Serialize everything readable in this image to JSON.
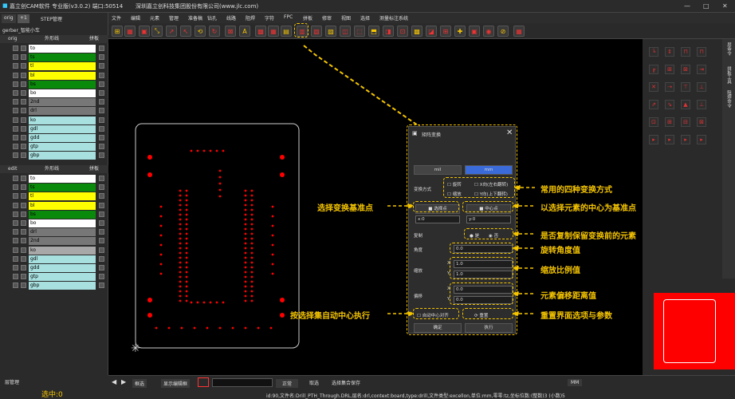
{
  "title": {
    "app": "嘉立创CAM软件 专业版(v3.0.2) 端口:50514",
    "company": "深圳嘉立创科技集团股份有限公司(www.jlc.com)"
  },
  "menus": [
    "文件",
    "编辑",
    "元素",
    "管理",
    "准备稿",
    "钻孔",
    "线路",
    "阻焊",
    "字符",
    "FPC",
    "拼板",
    "修审",
    "视图",
    "选择",
    "测量标注",
    "系统"
  ],
  "left": {
    "tabs": [
      "orig",
      "+1",
      "STEP管理"
    ],
    "job": "gerber_智能小车",
    "orig_head": "orig",
    "orig_opts": [
      "外形线",
      "拼板"
    ],
    "orig_layers": [
      {
        "name": "to",
        "color": "#ffffff"
      },
      {
        "name": "ts",
        "color": "#0a8a0a"
      },
      {
        "name": "tl",
        "color": "#ffff00"
      },
      {
        "name": "bl",
        "color": "#ffff00"
      },
      {
        "name": "bs",
        "color": "#0a8a0a"
      },
      {
        "name": "bo",
        "color": "#ffffff"
      },
      {
        "name": "2nd",
        "color": "#777777"
      },
      {
        "name": "drl",
        "color": "#777777"
      },
      {
        "name": "ko",
        "color": "#a8e0e0"
      },
      {
        "name": "gdl",
        "color": "#a8e0e0"
      },
      {
        "name": "gdd",
        "color": "#a8e0e0"
      },
      {
        "name": "gtp",
        "color": "#a8e0e0"
      },
      {
        "name": "gbp",
        "color": "#a8e0e0"
      }
    ],
    "edit_head": "edit",
    "edit_opts": [
      "外形线",
      "拼板"
    ],
    "edit_layers": [
      {
        "name": "to",
        "color": "#ffffff"
      },
      {
        "name": "ts",
        "color": "#0a8a0a"
      },
      {
        "name": "tl",
        "color": "#ffff00"
      },
      {
        "name": "bl",
        "color": "#ffff00"
      },
      {
        "name": "bs",
        "color": "#0a8a0a"
      },
      {
        "name": "bo",
        "color": "#ffffff"
      },
      {
        "name": "drl",
        "color": "#777777"
      },
      {
        "name": "2nd",
        "color": "#777777"
      },
      {
        "name": "ko",
        "color": "#a8a8a8"
      },
      {
        "name": "gdl",
        "color": "#a8e0e0"
      },
      {
        "name": "gdd",
        "color": "#a8e0e0"
      },
      {
        "name": "gtp",
        "color": "#a8e0e0"
      },
      {
        "name": "gbp",
        "color": "#a8e0e0"
      }
    ],
    "bottom_tab": "层管理",
    "selected": "选中:0"
  },
  "dialog": {
    "title": "矩阵变换",
    "units": [
      "mil",
      "mm"
    ],
    "mode_label": "变换方式",
    "modes": [
      "旋转",
      "X向(左右翻转)",
      "缩放",
      "Y向(上下翻转)"
    ],
    "base_btns": [
      "选择点",
      "中心点"
    ],
    "x_label": "x:0",
    "y_label": "y:0",
    "copy_label": "复制",
    "copy_opts": [
      "是",
      "否"
    ],
    "angle_label": "角度",
    "angle": "0.0",
    "scale_label": "缩放",
    "scale_x": "1.0",
    "scale_y": "1.0",
    "offset_label": "偏移",
    "off_x": "0.0",
    "off_y": "0.0",
    "auto_center": "自动中心对齐",
    "reset": "重置",
    "ok": "确定",
    "exec": "执行",
    "xl": "X",
    "yl": "Y"
  },
  "annotations": {
    "modes": "常用的四种变换方式",
    "base": "选择变换基准点",
    "center": "以选择元素的中心为基准点",
    "copy": "是否复制保留变换前的元素",
    "angle": "旋转角度值",
    "scale": "缩放比例值",
    "offset": "元素偏移距离值",
    "auto": "按选择集自动中心执行",
    "reset": "重置界面选项与参数"
  },
  "right_vlabels": [
    "层命令",
    "拼板工具",
    "阻焊命令"
  ],
  "status": {
    "zoom_mode": "框选",
    "show_btn": "显示编辑框",
    "layer_sel": "正常",
    "btn1": "取选",
    "btn2": "选择集合保存",
    "unit": "MM",
    "info": "id:90,文件名:Drill_PTH_Through.DRL,层名:drl,context:board,type:drill,文件类型:excellon,单位:mm,零零:tz,坐标位数:(整数)3 (小数)5"
  },
  "colors": {
    "accent": "#f5c500",
    "pad": "#ff0000",
    "board_outline": "#cccccc",
    "highlight": "#3a6bd9"
  }
}
